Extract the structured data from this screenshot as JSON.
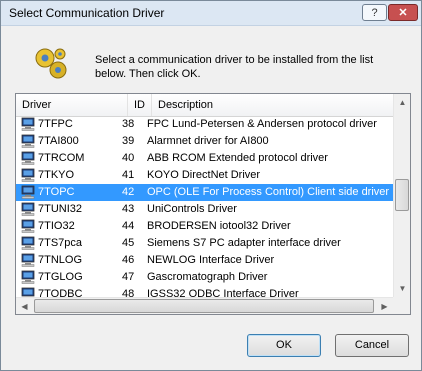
{
  "window": {
    "title": "Select Communication Driver",
    "help_label": "?",
    "close_label": "✕"
  },
  "instruction": "Select a communication driver to be installed from the list\nbelow. Then click OK.",
  "list": {
    "columns": [
      "Driver",
      "ID",
      "Description"
    ],
    "rows": [
      {
        "name": "7TFPC",
        "id": "38",
        "description": "FPC Lund-Petersen & Andersen protocol driver",
        "selected": false
      },
      {
        "name": "7TAI800",
        "id": "39",
        "description": "Alarmnet driver for AI800",
        "selected": false
      },
      {
        "name": "7TRCOM",
        "id": "40",
        "description": "ABB RCOM Extended protocol driver",
        "selected": false
      },
      {
        "name": "7TKYO",
        "id": "41",
        "description": "KOYO DirectNet Driver",
        "selected": false
      },
      {
        "name": "7TOPC",
        "id": "42",
        "description": "OPC (OLE For Process Control) Client side driver",
        "selected": true
      },
      {
        "name": "7TUNI32",
        "id": "43",
        "description": "UniControls Driver",
        "selected": false
      },
      {
        "name": "7TIO32",
        "id": "44",
        "description": "BRODERSEN iotool32 Driver",
        "selected": false
      },
      {
        "name": "7TS7pca",
        "id": "45",
        "description": "Siemens S7 PC adapter interface driver",
        "selected": false
      },
      {
        "name": "7TNLOG",
        "id": "46",
        "description": "NEWLOG Interface Driver",
        "selected": false
      },
      {
        "name": "7TGLOG",
        "id": "47",
        "description": "Gascromatograph Driver",
        "selected": false
      },
      {
        "name": "7TODBC",
        "id": "48",
        "description": "IGSS32 ODBC Interface Driver",
        "selected": false
      }
    ]
  },
  "buttons": {
    "ok": "OK",
    "cancel": "Cancel"
  }
}
